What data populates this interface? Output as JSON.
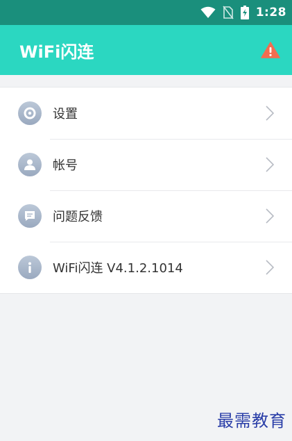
{
  "status_bar": {
    "time": "1:28",
    "icons": [
      "wifi-icon",
      "no-sim-icon",
      "battery-charging-icon"
    ]
  },
  "app_bar": {
    "title": "WiFi闪连",
    "action_icon": "warning-icon",
    "accent_color": "#2bd7c1",
    "warning_color": "#f26d50"
  },
  "menu": {
    "items": [
      {
        "icon": "settings-icon",
        "label": "设置"
      },
      {
        "icon": "account-icon",
        "label": "帐号"
      },
      {
        "icon": "feedback-icon",
        "label": "问题反馈"
      },
      {
        "icon": "info-icon",
        "label": "WiFi闪连  V4.1.2.1014"
      }
    ]
  },
  "watermark": "最需教育"
}
